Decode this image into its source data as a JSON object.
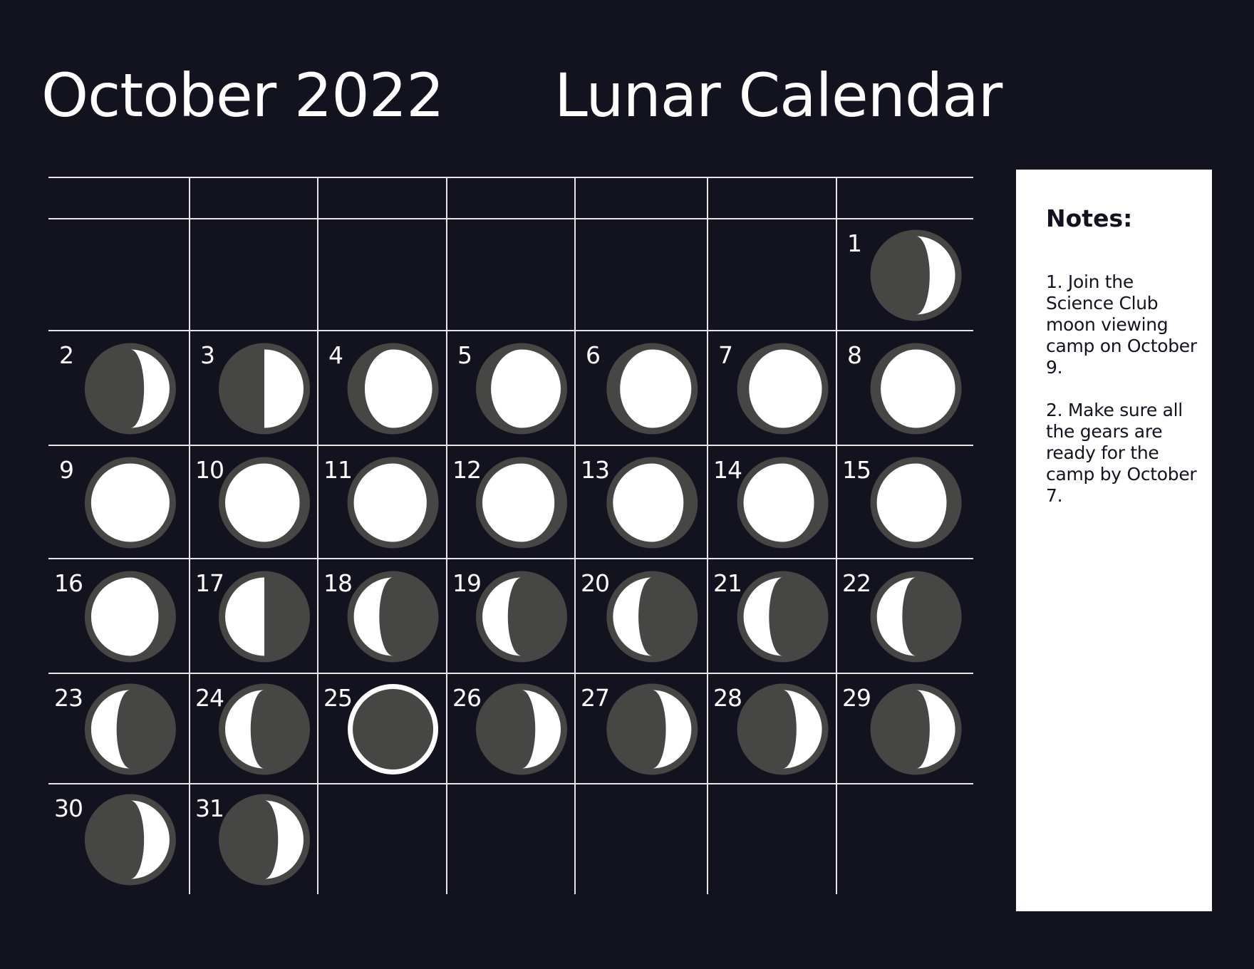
{
  "header": {
    "month_title": "October 2022",
    "main_title": "Lunar Calendar"
  },
  "calendar": {
    "month": "October",
    "year": 2022,
    "first_weekday_column": 7,
    "weekday_labels": [
      "",
      "",
      "",
      "",
      "",
      "",
      ""
    ],
    "colors": {
      "background": "#131320",
      "grid_line": "#e6e6e6",
      "moon_dark": "#464644",
      "moon_lit": "#ffffff"
    },
    "days": [
      {
        "day": "1",
        "phase": "waxing crescent",
        "lit_side": "right",
        "terminator": -0.35
      },
      {
        "day": "2",
        "phase": "waxing crescent",
        "lit_side": "right",
        "terminator": -0.35
      },
      {
        "day": "3",
        "phase": "first quarter",
        "lit_side": "right",
        "terminator": 0
      },
      {
        "day": "4",
        "phase": "waxing gibbous",
        "lit_side": "right",
        "terminator": 0.72
      },
      {
        "day": "5",
        "phase": "waxing gibbous",
        "lit_side": "right",
        "terminator": 0.78
      },
      {
        "day": "6",
        "phase": "waxing gibbous",
        "lit_side": "right",
        "terminator": 0.82
      },
      {
        "day": "7",
        "phase": "waxing gibbous",
        "lit_side": "right",
        "terminator": 0.86
      },
      {
        "day": "8",
        "phase": "waxing gibbous",
        "lit_side": "right",
        "terminator": 0.9
      },
      {
        "day": "9",
        "phase": "full moon",
        "lit_side": "both",
        "terminator": 1
      },
      {
        "day": "10",
        "phase": "waning gibbous",
        "lit_side": "left",
        "terminator": 0.9
      },
      {
        "day": "11",
        "phase": "waning gibbous",
        "lit_side": "left",
        "terminator": 0.86
      },
      {
        "day": "12",
        "phase": "waning gibbous",
        "lit_side": "left",
        "terminator": 0.84
      },
      {
        "day": "13",
        "phase": "waning gibbous",
        "lit_side": "left",
        "terminator": 0.8
      },
      {
        "day": "14",
        "phase": "waning gibbous",
        "lit_side": "left",
        "terminator": 0.8
      },
      {
        "day": "15",
        "phase": "waning gibbous",
        "lit_side": "left",
        "terminator": 0.78
      },
      {
        "day": "16",
        "phase": "waning gibbous",
        "lit_side": "left",
        "terminator": 0.72
      },
      {
        "day": "17",
        "phase": "last quarter",
        "lit_side": "left",
        "terminator": 0
      },
      {
        "day": "18",
        "phase": "waning crescent",
        "lit_side": "left",
        "terminator": -0.35
      },
      {
        "day": "19",
        "phase": "waning crescent",
        "lit_side": "left",
        "terminator": -0.35
      },
      {
        "day": "20",
        "phase": "waning crescent",
        "lit_side": "left",
        "terminator": -0.35
      },
      {
        "day": "21",
        "phase": "waning crescent",
        "lit_side": "left",
        "terminator": -0.35
      },
      {
        "day": "22",
        "phase": "waning crescent",
        "lit_side": "left",
        "terminator": -0.35
      },
      {
        "day": "23",
        "phase": "waning crescent",
        "lit_side": "left",
        "terminator": -0.35
      },
      {
        "day": "24",
        "phase": "waning crescent",
        "lit_side": "left",
        "terminator": -0.35
      },
      {
        "day": "25",
        "phase": "new moon",
        "lit_side": "none",
        "terminator": -1
      },
      {
        "day": "26",
        "phase": "waxing crescent",
        "lit_side": "right",
        "terminator": -0.35
      },
      {
        "day": "27",
        "phase": "waxing crescent",
        "lit_side": "right",
        "terminator": -0.35
      },
      {
        "day": "28",
        "phase": "waxing crescent",
        "lit_side": "right",
        "terminator": -0.35
      },
      {
        "day": "29",
        "phase": "waxing crescent",
        "lit_side": "right",
        "terminator": -0.35
      },
      {
        "day": "30",
        "phase": "waxing crescent",
        "lit_side": "right",
        "terminator": -0.35
      },
      {
        "day": "31",
        "phase": "waxing crescent",
        "lit_side": "right",
        "terminator": -0.35
      }
    ]
  },
  "notes": {
    "title": "Notes:",
    "items": [
      "1. Join the Science Club moon viewing camp on October 9.",
      "2. Make sure all the gears are ready for the camp by October 7."
    ]
  }
}
